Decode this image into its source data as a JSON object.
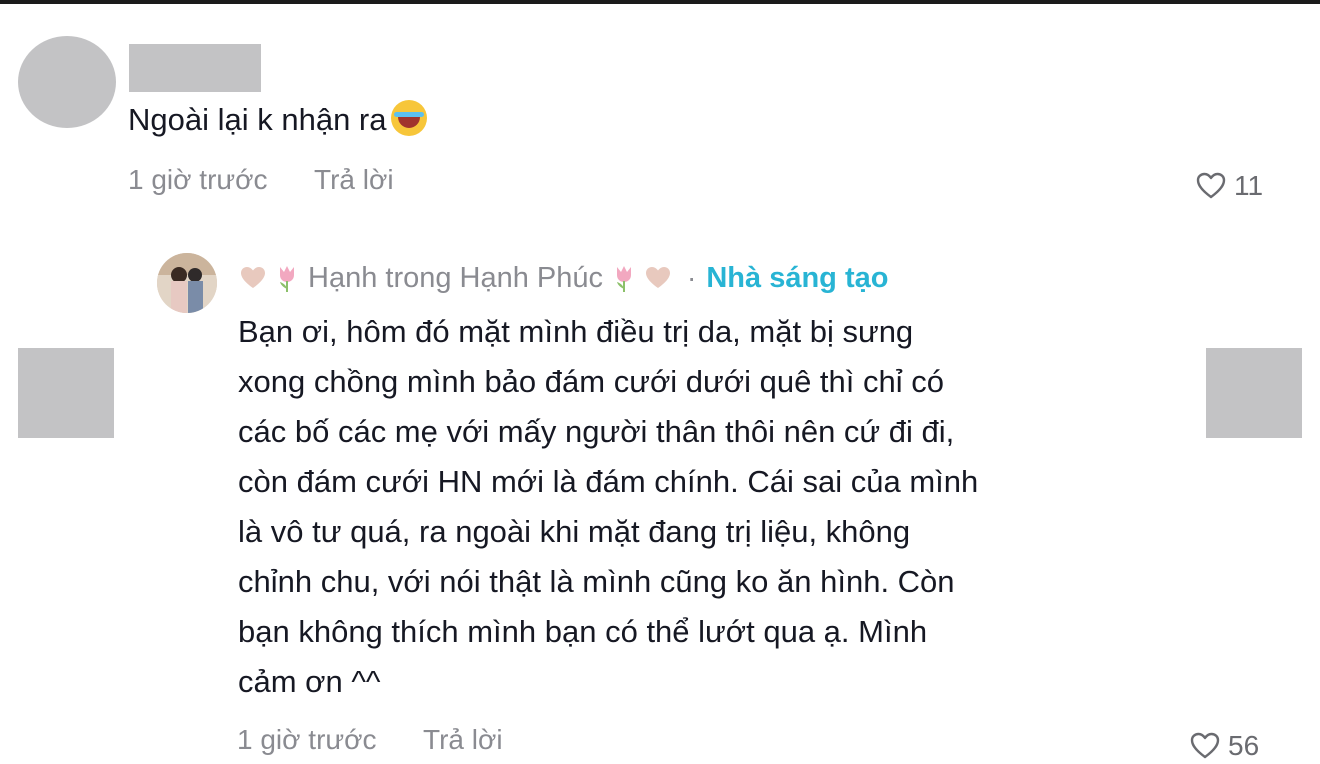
{
  "comment": {
    "text": "Ngoài lại k nhận ra",
    "emoji": "laughing-tears-emoji",
    "time": "1 giờ trước",
    "reply_label": "Trả lời",
    "likes": "11"
  },
  "reply": {
    "username": "Hạnh trong Hạnh Phúc",
    "separator": "·",
    "badge": "Nhà sáng tạo",
    "lines": [
      "Bạn ơi, hôm đó mặt mình điều trị da, mặt bị sưng",
      "xong chồng mình bảo đám cưới dưới quê thì chỉ có",
      "các bố các mẹ với mấy người thân thôi nên cứ đi đi,",
      "còn đám cưới HN mới là đám chính. Cái sai của mình",
      "là vô tư quá, ra ngoài khi mặt đang trị liệu, không",
      "chỉnh chu, với nói thật là mình cũng ko ăn hình. Còn",
      "bạn không thích mình bạn có thể lướt qua ạ. Mình",
      "cảm ơn ^^"
    ],
    "time": "1 giờ trước",
    "reply_label": "Trả lời",
    "likes": "56"
  },
  "colors": {
    "text": "#161823",
    "muted": "#8a8b91",
    "creator": "#28b4d4",
    "redaction": "#c3c3c5"
  }
}
